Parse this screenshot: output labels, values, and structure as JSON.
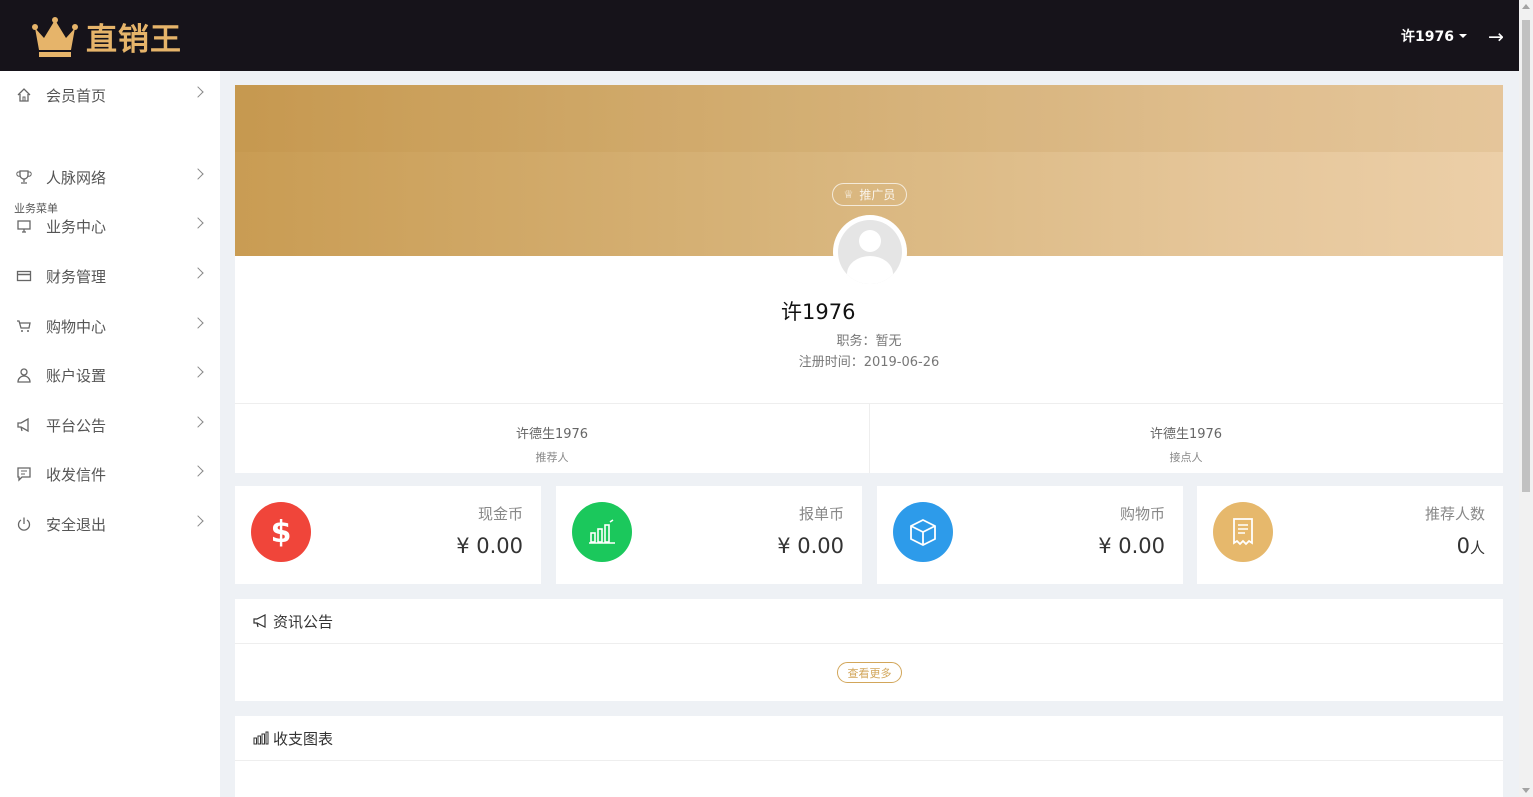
{
  "header": {
    "brand": "直销王",
    "user": "许1976"
  },
  "sidebar": {
    "section_label": "业务菜单",
    "items": [
      {
        "label": "会员首页",
        "icon": "home-icon"
      },
      {
        "label": "人脉网络",
        "icon": "trophy-icon"
      },
      {
        "label": "业务中心",
        "icon": "monitor-icon"
      },
      {
        "label": "财务管理",
        "icon": "credit-card-icon"
      },
      {
        "label": "购物中心",
        "icon": "cart-icon"
      },
      {
        "label": "账户设置",
        "icon": "user-icon"
      },
      {
        "label": "平台公告",
        "icon": "megaphone-icon"
      },
      {
        "label": "收发信件",
        "icon": "message-icon"
      },
      {
        "label": "安全退出",
        "icon": "power-icon"
      }
    ]
  },
  "profile": {
    "badge": "推广员",
    "name": "许1976",
    "job": "职务：暂无",
    "reg_time": "注册时间：2019-06-26",
    "referrer_name": "许德生1976",
    "referrer_role": "推荐人",
    "contact_name": "许德生1976",
    "contact_role": "接点人"
  },
  "stats": [
    {
      "label": "现金币",
      "value": "¥ 0.00",
      "color": "#f0453a",
      "icon": "dollar-icon"
    },
    {
      "label": "报单币",
      "value": "¥ 0.00",
      "color": "#1bc85c",
      "icon": "bar-chart-icon"
    },
    {
      "label": "购物币",
      "value": "¥ 0.00",
      "color": "#2d9bea",
      "icon": "box-icon"
    },
    {
      "label": "推荐人数",
      "value": "0",
      "unit": "人",
      "color": "#e6b86c",
      "icon": "receipt-icon"
    }
  ],
  "news": {
    "title": "资讯公告",
    "more": "查看更多"
  },
  "chart_panel": {
    "title": "收支图表"
  }
}
